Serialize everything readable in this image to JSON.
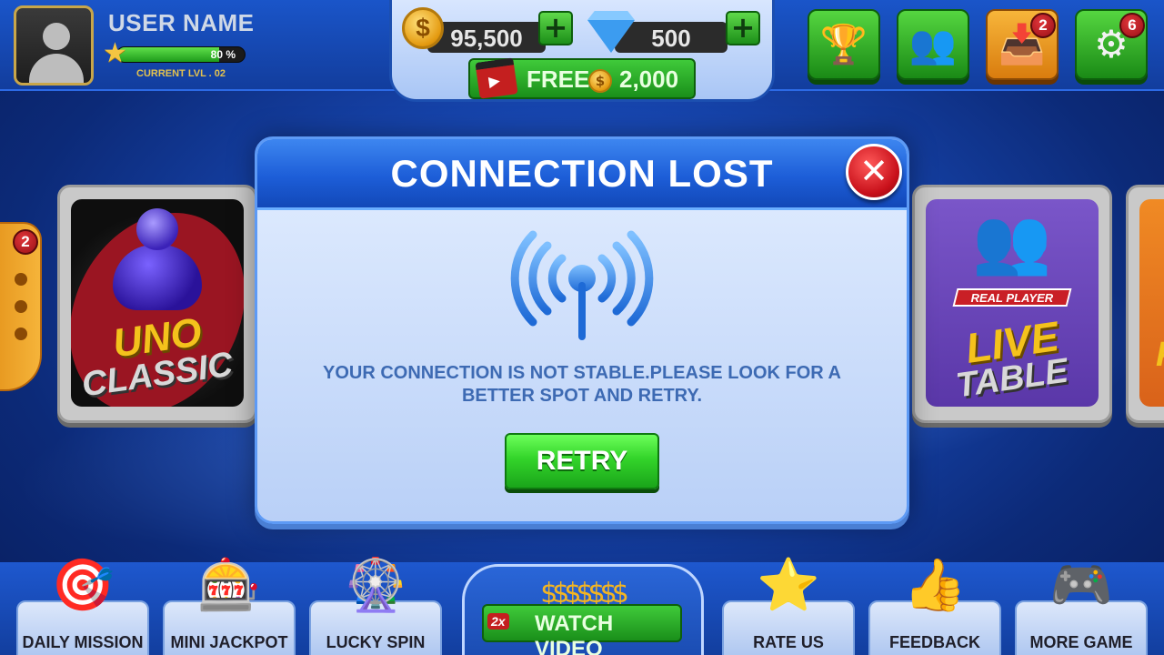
{
  "profile": {
    "username": "USER NAME",
    "level_progress_pct": 80,
    "level_progress_label": "80 %",
    "level_text": "CURRENT LVL . 02"
  },
  "currency": {
    "coins": "95,500",
    "gems": "500",
    "coin_symbol": "$",
    "plus_symbol": "+",
    "free_label": "FREE",
    "free_amount": "2,000"
  },
  "top_buttons": [
    {
      "name": "trophy-icon",
      "glyph": "🏆",
      "badge": null
    },
    {
      "name": "friends-icon",
      "glyph": "👥",
      "badge": null
    },
    {
      "name": "inbox-icon",
      "glyph": "📥",
      "badge": "2"
    },
    {
      "name": "gear-icon",
      "glyph": "⚙",
      "badge": "6"
    }
  ],
  "side_menu": {
    "badge": "2"
  },
  "cards": {
    "uno_title_1": "UNO",
    "uno_title_2": "CLASSIC",
    "live_ribbon": "REAL PLAYER",
    "live_title_1": "LIVE",
    "live_title_2": "TABLE",
    "far_letter": "P"
  },
  "modal": {
    "title": "CONNECTION LOST",
    "close_symbol": "✕",
    "message": "YOUR CONNECTION IS NOT STABLE.PLEASE LOOK FOR A BETTER SPOT AND RETRY.",
    "retry_label": "RETRY"
  },
  "bottom_nav": [
    {
      "label": "DAILY MISSION",
      "icon": "🎯"
    },
    {
      "label": "MINI JACKPOT",
      "icon": "🎰"
    },
    {
      "label": "LUCKY SPIN",
      "icon": "🎡"
    },
    {
      "label": "RATE US",
      "icon": "⭐"
    },
    {
      "label": "FEEDBACK",
      "icon": "👍"
    },
    {
      "label": "MORE GAME",
      "icon": "🎮"
    }
  ],
  "watch_video": {
    "label": "WATCH VIDEO",
    "multiplier": "2x"
  },
  "colors": {
    "accent_green": "#33d42a",
    "modal_blue": "#1d5ed8",
    "message_text": "#3d6ab3",
    "close_red": "#c8101a",
    "gold": "#f4c21c"
  }
}
